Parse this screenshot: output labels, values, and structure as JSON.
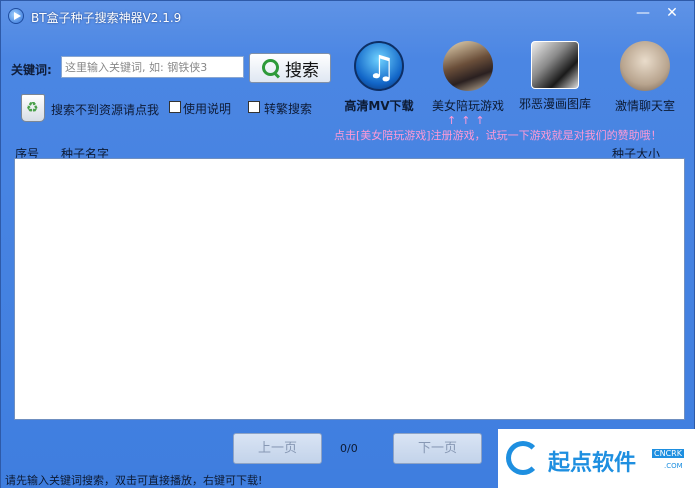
{
  "window": {
    "title": "BT盒子种子搜索神器V2.1.9",
    "minimize": "—",
    "close": "✕"
  },
  "search": {
    "label": "关键词:",
    "placeholder": "这里输入关键词, 如: 钢铁侠3",
    "button_label": "搜索"
  },
  "options": {
    "not_found_link": "搜索不到资源请点我",
    "help_label": "使用说明",
    "convert_label": "转繁搜索"
  },
  "apps": [
    {
      "label": "高清MV下载",
      "icon": "music-note-icon"
    },
    {
      "label": "美女陪玩游戏",
      "icon": "game-avatar-icon"
    },
    {
      "label": "邪恶漫画图库",
      "icon": "comic-icon"
    },
    {
      "label": "激情聊天室",
      "icon": "chat-avatar-icon"
    }
  ],
  "promo": {
    "arrows": "↑↑↑",
    "text": "点击[美女陪玩游戏]注册游戏，试玩一下游戏就是对我们的赞助哦！"
  },
  "list": {
    "col_index": "序号",
    "col_name": "种子名字",
    "col_size": "种子大小"
  },
  "pager": {
    "prev": "上一页",
    "next": "下一页",
    "indicator": "0/0"
  },
  "status": {
    "text": "请先输入关键词搜索，双击可直接播放，右键可下载!"
  },
  "watermark": {
    "text": "起点软件",
    "badge": "CNCRK",
    "badge2": ".COM"
  },
  "colors": {
    "window_bg": "#3f7edf",
    "promo": "#ff9ad6",
    "watermark": "#1e8fe0"
  }
}
